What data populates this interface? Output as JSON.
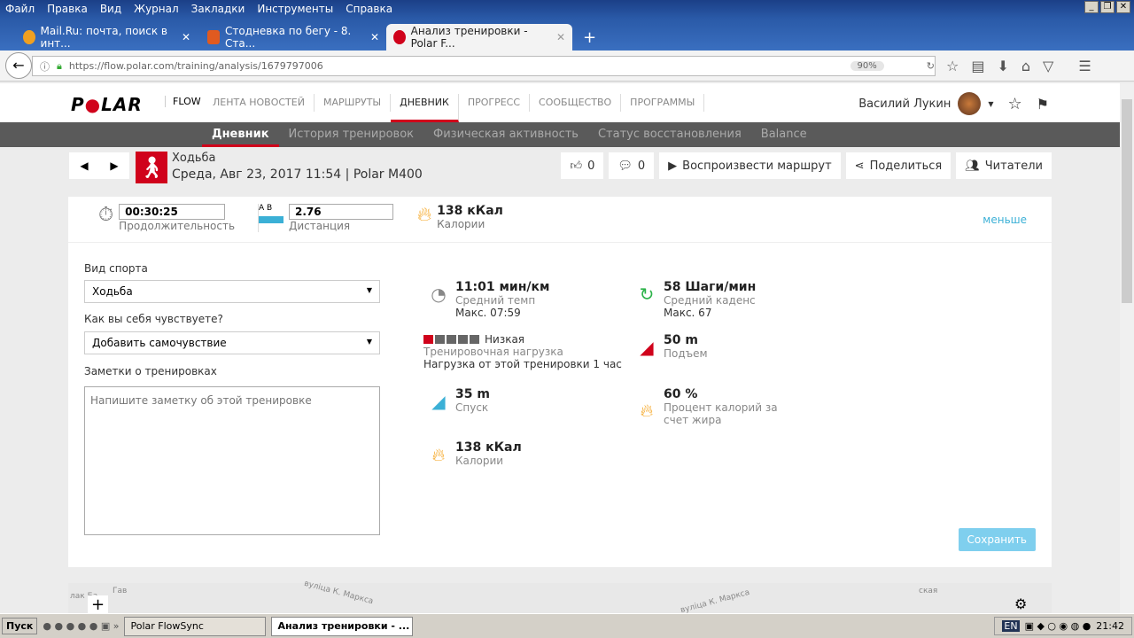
{
  "menu": [
    "Файл",
    "Правка",
    "Вид",
    "Журнал",
    "Закладки",
    "Инструменты",
    "Справка"
  ],
  "tabs": [
    {
      "label": "Mail.Ru: почта, поиск в инт..."
    },
    {
      "label": "Стодневка по бегу - 8. Ста..."
    },
    {
      "label": "Анализ тренировки - Polar F..."
    }
  ],
  "url": "https://flow.polar.com/training/analysis/1679797006",
  "zoom": "90%",
  "site": {
    "logo": "POLAR",
    "flow": "FLOW",
    "nav": [
      "ЛЕНТА НОВОСТЕЙ",
      "МАРШРУТЫ",
      "ДНЕВНИК",
      "ПРОГРЕСС",
      "СООБЩЕСТВО",
      "ПРОГРАММЫ"
    ],
    "user": "Василий Лукин"
  },
  "subnav": [
    "Дневник",
    "История тренировок",
    "Физическая активность",
    "Статус восстановления",
    "Balance"
  ],
  "activity": {
    "sport": "Ходьба",
    "date": "Среда, Авг 23, 2017 11:54 | Polar M400",
    "likes": "0",
    "comments": "0",
    "replay": "Воспроизвести маршрут",
    "share": "Поделиться",
    "readers": "Читатели"
  },
  "summary": {
    "duration": "00:30:25",
    "duration_label": "Продолжительность",
    "ab": "A  B",
    "distance": "2.76",
    "distance_label": "Дистанция",
    "calories": "138 кКал",
    "calories_label": "Калории",
    "less": "меньше"
  },
  "form": {
    "sport_label": "Вид спорта",
    "sport_value": "Ходьба",
    "feel_label": "Как вы себя чувствуете?",
    "feel_value": "Добавить самочувствие",
    "notes_label": "Заметки о тренировках",
    "notes_placeholder": "Напишите заметку об этой тренировке",
    "save": "Сохранить"
  },
  "metrics": {
    "pace": {
      "value": "11:01 мин/км",
      "label": "Средний темп",
      "sub": "Макс. 07:59"
    },
    "cadence": {
      "value": "58 Шаги/мин",
      "label": "Средний каденс",
      "sub": "Макс. 67"
    },
    "load": {
      "value": "Низкая",
      "label": "Тренировочная нагрузка",
      "sub": "Нагрузка от этой тренировки 1 час",
      "level": 1,
      "of": 5
    },
    "ascent": {
      "value": "50 m",
      "label": "Подъем"
    },
    "descent": {
      "value": "35 m",
      "label": "Спуск"
    },
    "fat": {
      "value": "60 %",
      "label": "Процент калорий за счет жира"
    },
    "calories": {
      "value": "138 кКал",
      "label": "Калории"
    }
  },
  "map": [
    "лак Ба",
    "Гав",
    "вуліца К. Маркса",
    "вуліца К. Маркса",
    "ская"
  ],
  "taskbar": {
    "start": "Пуск",
    "tasks": [
      "Polar FlowSync",
      "Анализ тренировки - ..."
    ],
    "lang": "EN",
    "time": "21:42"
  }
}
